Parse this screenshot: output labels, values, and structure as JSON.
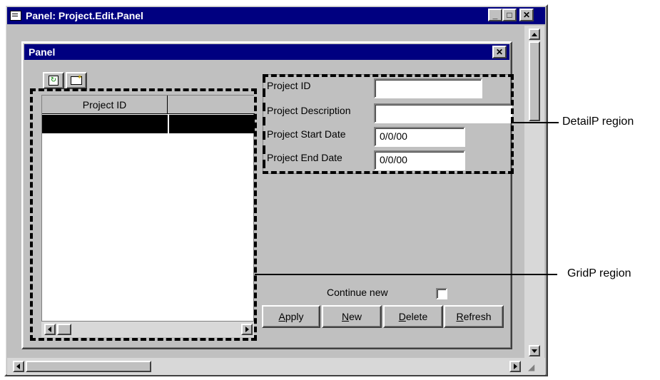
{
  "outer_window": {
    "title": "Panel: Project.Edit.Panel",
    "minimize": "_",
    "maximize": "□",
    "close": "✕"
  },
  "inner_panel": {
    "title": "Panel",
    "close": "✕"
  },
  "grid": {
    "columns": [
      "Project ID",
      ""
    ],
    "toolbar": [
      "refresh-icon",
      "new-record-icon"
    ]
  },
  "detail": {
    "project_id_label": "Project ID",
    "project_id_value": "",
    "project_description_label": "Project Description",
    "project_description_value": "",
    "project_start_date_label": "Project Start Date",
    "project_start_date_value": "0/0/00",
    "project_end_date_label": "Project End Date",
    "project_end_date_value": "0/0/00"
  },
  "continue_new_label": "Continue new",
  "continue_new_checked": false,
  "buttons": {
    "apply_first": "A",
    "apply_rest": "pply",
    "new_first": "N",
    "new_rest": "ew",
    "delete_first": "D",
    "delete_rest": "elete",
    "refresh_first": "R",
    "refresh_rest": "efresh"
  },
  "callouts": {
    "detail": "DetailP region",
    "grid": "GridP region"
  }
}
